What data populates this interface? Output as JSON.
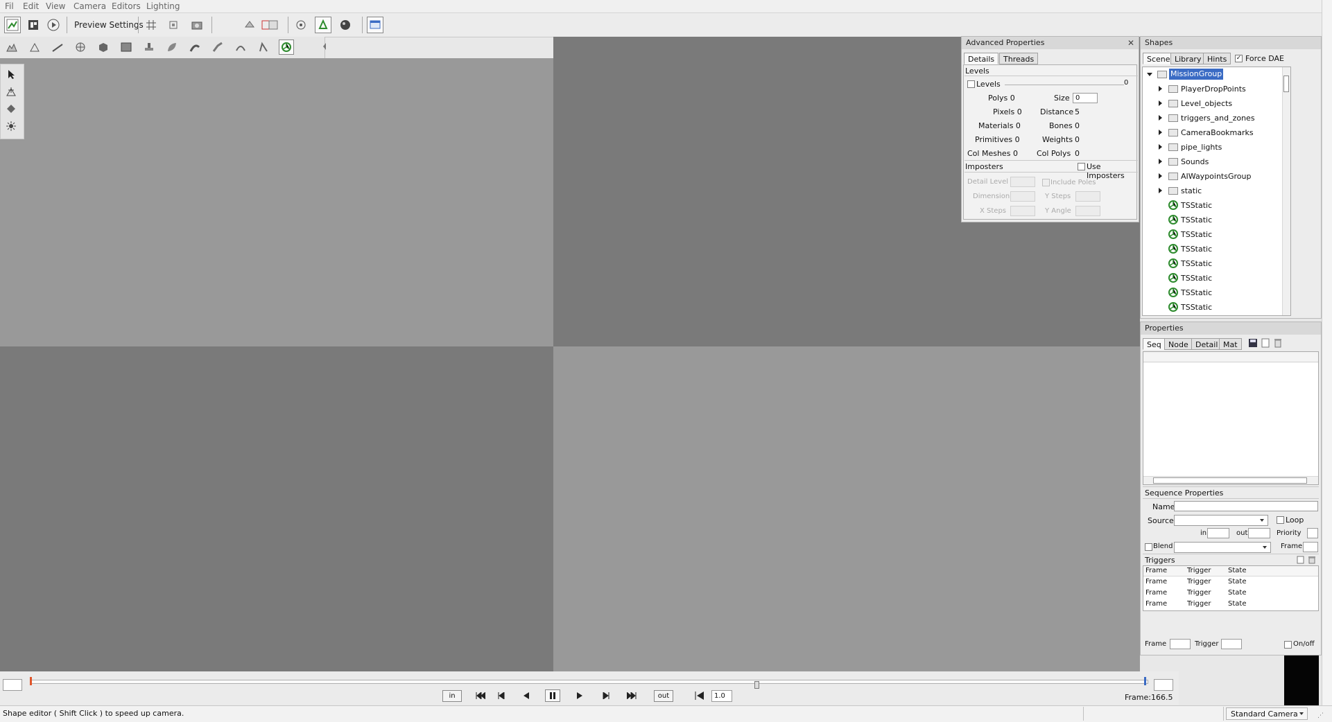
{
  "menu": [
    "Fil",
    "Edit",
    "View",
    "Camera",
    "Editors",
    "Lighting"
  ],
  "toolbar": {
    "preview_settings": "Preview Settings"
  },
  "advanced": {
    "title": "Advanced Properties",
    "tabs": [
      "Details",
      "Threads"
    ],
    "levels_header": "Levels",
    "levels_check": "Levels",
    "levels_value": "0",
    "stats_left": [
      {
        "label": "Polys",
        "value": "0"
      },
      {
        "label": "Pixels",
        "value": "0"
      },
      {
        "label": "Materials",
        "value": "0"
      },
      {
        "label": "Primitives",
        "value": "0"
      },
      {
        "label": "Col Meshes",
        "value": "0"
      }
    ],
    "stats_right": [
      {
        "label": "Size",
        "value": "0"
      },
      {
        "label": "Distance",
        "value": "5"
      },
      {
        "label": "Bones",
        "value": "0"
      },
      {
        "label": "Weights",
        "value": "0"
      },
      {
        "label": "Col Polys",
        "value": "0"
      }
    ],
    "imposters_header": "Imposters",
    "use_imposters": "Use Imposters",
    "detail_level": "Detail Level",
    "include_poles": "Include Poles",
    "dimension": "Dimension",
    "y_steps": "Y Steps",
    "x_steps": "X Steps",
    "y_angle": "Y Angle"
  },
  "shapes": {
    "title": "Shapes",
    "tabs": [
      "Scene",
      "Library",
      "Hints"
    ],
    "force_dae": "Force DAE",
    "root": "MissionGroup",
    "folders": [
      "PlayerDropPoints",
      "Level_objects",
      "triggers_and_zones",
      "CameraBookmarks",
      "pipe_lights",
      "Sounds",
      "AIWaypointsGroup",
      "static"
    ],
    "statics": [
      "TSStatic",
      "TSStatic",
      "TSStatic",
      "TSStatic",
      "TSStatic",
      "TSStatic",
      "TSStatic",
      "TSStatic"
    ]
  },
  "properties": {
    "title": "Properties",
    "tabs": [
      "Seq",
      "Node",
      "Detail",
      "Mat"
    ],
    "seq_header": "Sequence Properties",
    "name": "Name",
    "source": "Source",
    "loop": "Loop",
    "in": "in",
    "out": "out",
    "priority": "Priority",
    "blend": "Blend",
    "frame": "Frame",
    "triggers": "Triggers",
    "trigger_cols": [
      "Frame",
      "Trigger",
      "State"
    ],
    "trigger_rows": [
      [
        "Frame",
        "Trigger",
        "State"
      ],
      [
        "Frame",
        "Trigger",
        "State"
      ],
      [
        "Frame",
        "Trigger",
        "State"
      ]
    ],
    "bottom_frame": "Frame",
    "bottom_trigger": "Trigger",
    "onoff": "On/off"
  },
  "timeline": {
    "in": "in",
    "out": "out",
    "speed": "1.0",
    "frame_label": "Frame:",
    "frame_value": "166.5"
  },
  "status": {
    "text": "Shape editor ( Shift Click ) to speed up camera.",
    "camera": "Standard Camera"
  },
  "colors": {
    "vp_light": "#999999",
    "vp_dark": "#7a7a7a",
    "selection": "#3a6bc4",
    "ts_green": "#2e8b2e"
  }
}
